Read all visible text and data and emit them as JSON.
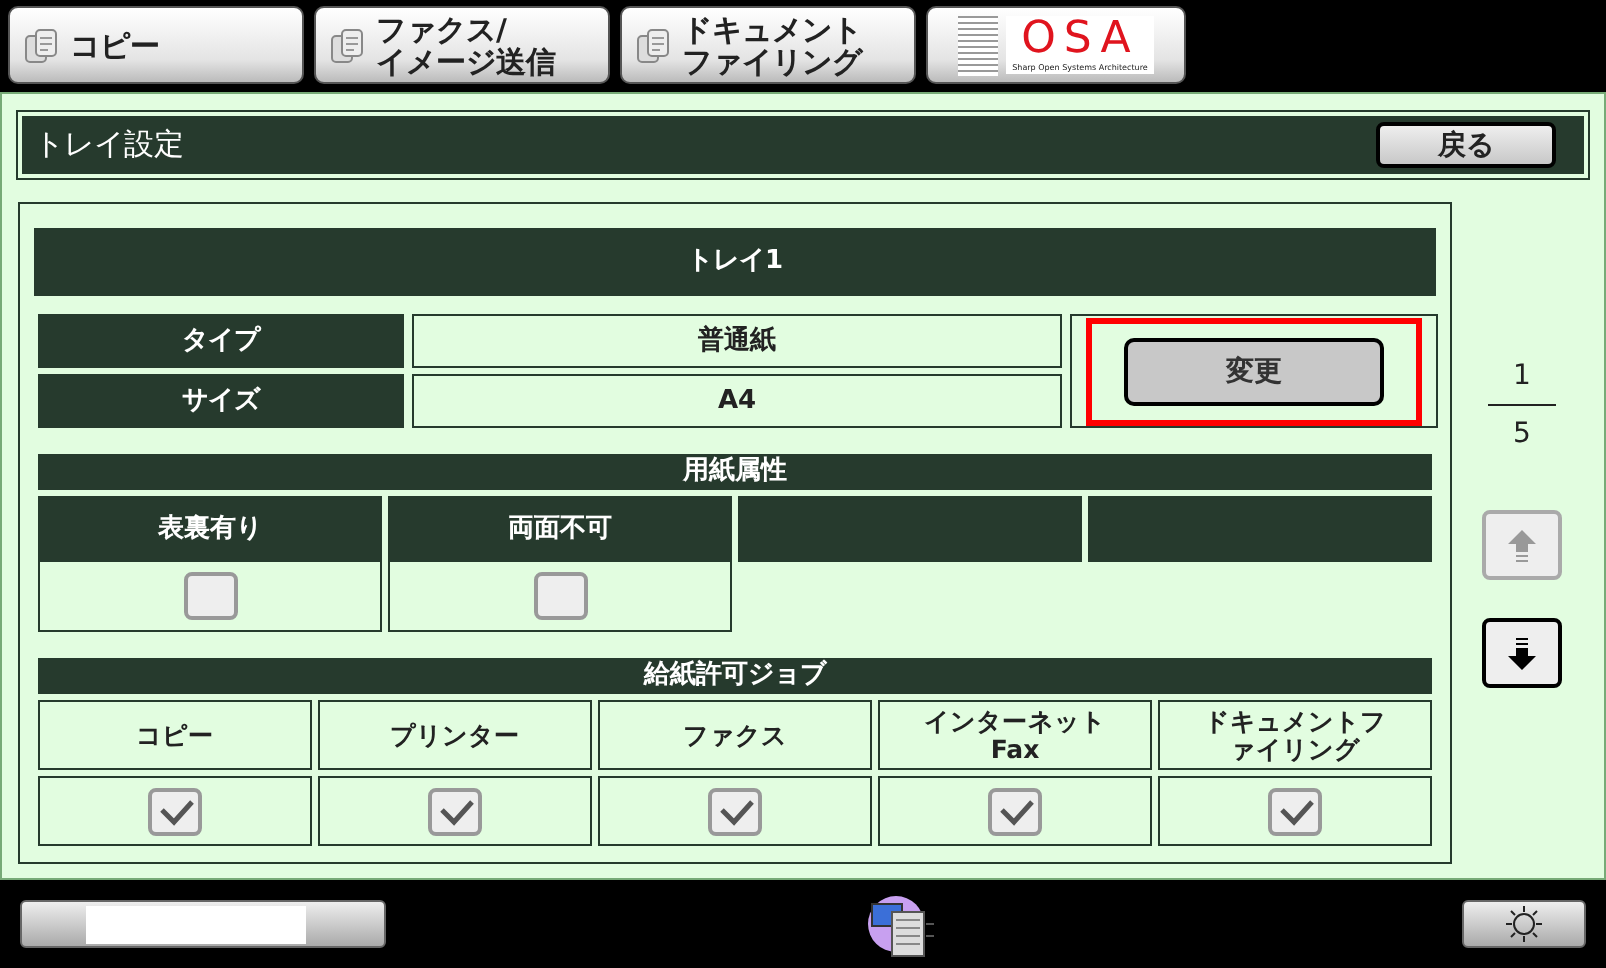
{
  "mode_tabs": [
    {
      "lines": [
        "コピー"
      ]
    },
    {
      "lines": [
        "ファクス/",
        "イメージ送信"
      ]
    },
    {
      "lines": [
        "ドキュメント",
        "ファイリング"
      ]
    }
  ],
  "osa_logo": {
    "text": "OSA",
    "tagline": "Sharp Open Systems Architecture"
  },
  "title_bar": {
    "title": "トレイ設定",
    "back_button": "戻る"
  },
  "tray": {
    "title": "トレイ1",
    "properties": [
      {
        "label": "タイプ",
        "value": "普通紙"
      },
      {
        "label": "サイズ",
        "value": "A4"
      }
    ],
    "change_button": {
      "label": "変更",
      "highlighted": true
    },
    "paper_attributes": {
      "title": "用紙属性",
      "columns": [
        {
          "label": "表裏有り",
          "checked": false
        },
        {
          "label": "両面不可",
          "checked": false
        }
      ]
    },
    "allowed_jobs": {
      "title": "給紙許可ジョブ",
      "columns": [
        {
          "lines": [
            "コピー"
          ],
          "checked": true
        },
        {
          "lines": [
            "プリンター"
          ],
          "checked": true
        },
        {
          "lines": [
            "ファクス"
          ],
          "checked": true
        },
        {
          "lines": [
            "インターネット",
            "Fax"
          ],
          "checked": true
        },
        {
          "lines": [
            "ドキュメントフ",
            "ァイリング"
          ],
          "checked": true
        }
      ]
    }
  },
  "pager": {
    "current": "1",
    "total": "5",
    "up_disabled": true,
    "down_disabled": false
  }
}
